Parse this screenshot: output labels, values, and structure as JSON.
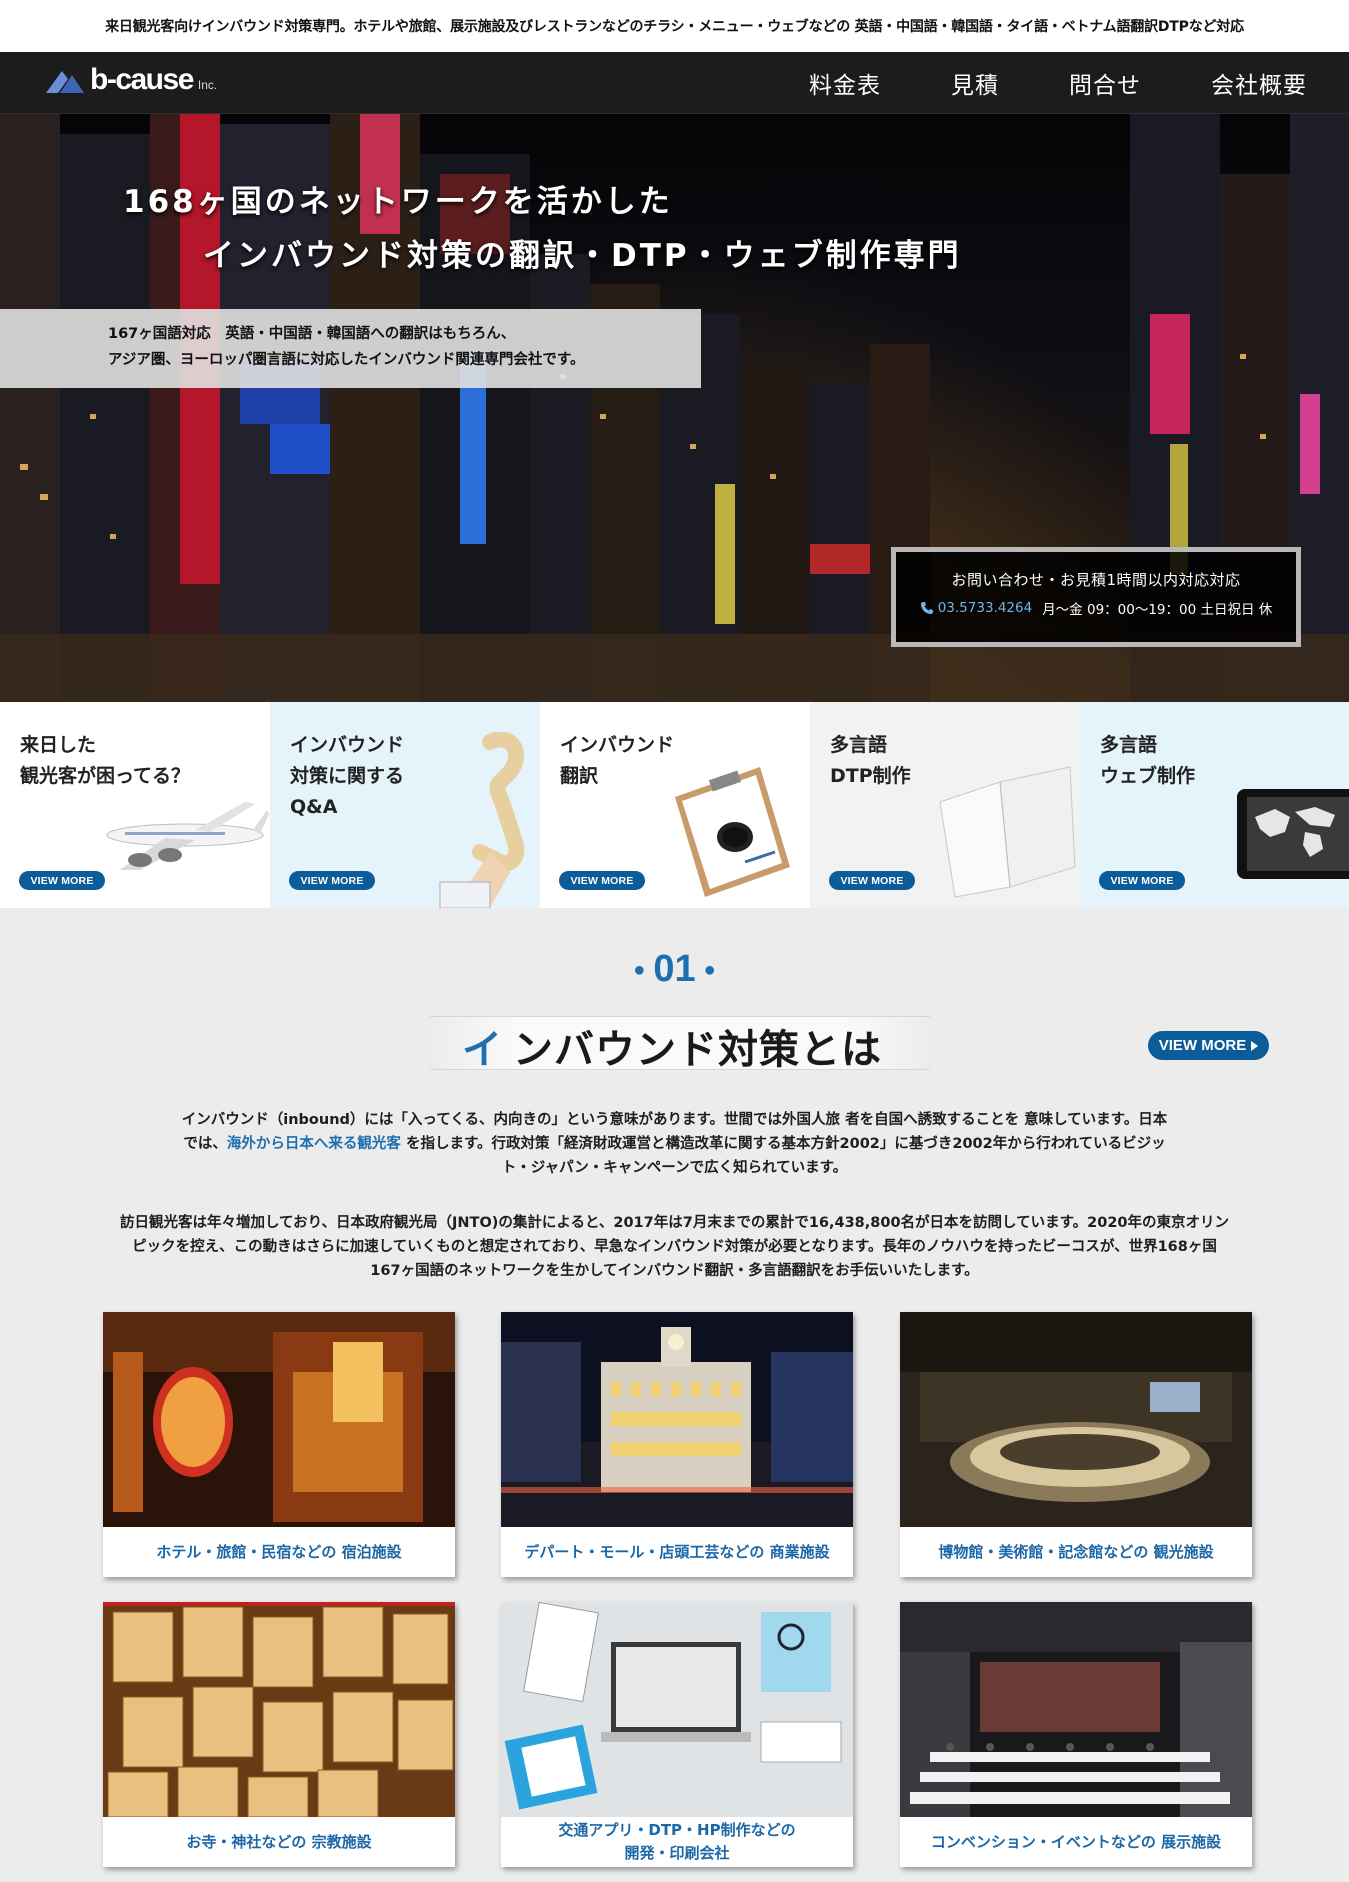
{
  "top_banner": "来日観光客向けインバウンド対策専門。ホテルや旅館、展示施設及びレストランなどのチラシ・メニュー・ウェブなどの 英語・中国語・韓国語・タイ語・ベトナム語翻訳DTPなど対応",
  "logo": {
    "text": "b-cause",
    "suffix": "Inc."
  },
  "nav": [
    "料金表",
    "見積",
    "問合せ",
    "会社概要"
  ],
  "hero": {
    "title_line1": "168ヶ国のネットワークを活かした",
    "title_line2": "インバウンド対策の翻訳・DTP・ウェブ制作専門",
    "sub_line1": "167ヶ国語対応　英語・中国語・韓国語への翻訳はもちろん、",
    "sub_line2": "アジア圏、ヨーロッパ圏言語に対応したインバウンド関連専門会社です。",
    "contact": {
      "line1": "お問い合わせ・お見積1時間以内対応対応",
      "phone": "03.5733.4264",
      "hours": "月〜金 09：00〜19：00 土日祝日 休"
    }
  },
  "cards": [
    {
      "line1": "来日した",
      "line2": "観光客が困ってる？",
      "line3": "",
      "button": "VIEW MORE"
    },
    {
      "line1": "インバウンド",
      "line2": "対策に関する",
      "line3": "Q&A",
      "button": "VIEW MORE"
    },
    {
      "line1": "インバウンド",
      "line2": "翻訳",
      "line3": "",
      "button": "VIEW MORE"
    },
    {
      "line1": "多言語",
      "line2": "DTP制作",
      "line3": "",
      "button": "VIEW MORE"
    },
    {
      "line1": "多言語",
      "line2": "ウェブ制作",
      "line3": "",
      "button": "VIEW MORE"
    }
  ],
  "section": {
    "number": "01",
    "title_first": "イ",
    "title_rest": "ンバウンド対策とは",
    "button": "VIEW MORE",
    "p1_a": "インバウンド（inbound）には「入ってくる、内向きの」という意味があります。世間では外国人旅 者を自国へ誘致することを 意味しています。日本",
    "p1_b": "では、",
    "p1_link": "海外から日本へ来る観光客",
    "p1_c": " を指します。行政対策「経済財政運営と構造改革に関する基本方針2002」に基づき2002年から行われているビジッ",
    "p1_d": "ト・ジャパン・キャンペーンで広く知られています。",
    "p2_a": "訪日観光客は年々増加しており、日本政府観光局（JNTO)の集計によると、2017年は7月末までの累計で16,438,800名が日本を訪問しています。2020年の東京オリン",
    "p2_b": "ピックを控え、この動きはさらに加速していくものと想定されており、早急なインバウンド対策が必要となります。長年のノウハウを持ったビーコスが、世界168ヶ国",
    "p2_c": "167ヶ国語のネットワークを生かしてインバウンド翻訳・多言語翻訳をお手伝いいたします。"
  },
  "tiles": [
    {
      "line1": "ホテル・旅館・民宿などの 宿泊施設",
      "line2": ""
    },
    {
      "line1": "デパート・モール・店頭工芸などの 商業施設",
      "line2": ""
    },
    {
      "line1": "博物館・美術館・記念館などの 観光施設",
      "line2": ""
    },
    {
      "line1": "お寺・神社などの 宗教施設",
      "line2": ""
    },
    {
      "line1": "交通アプリ・DTP・HP制作などの",
      "line2": "開発・印刷会社"
    },
    {
      "line1": "コンベンション・イベントなどの 展示施設",
      "line2": ""
    }
  ],
  "colors": {
    "accent": "#1d6fb0",
    "button": "#0c5c99",
    "nav_bg": "#1c1c1c",
    "card_blue": "#e5f4fb"
  }
}
